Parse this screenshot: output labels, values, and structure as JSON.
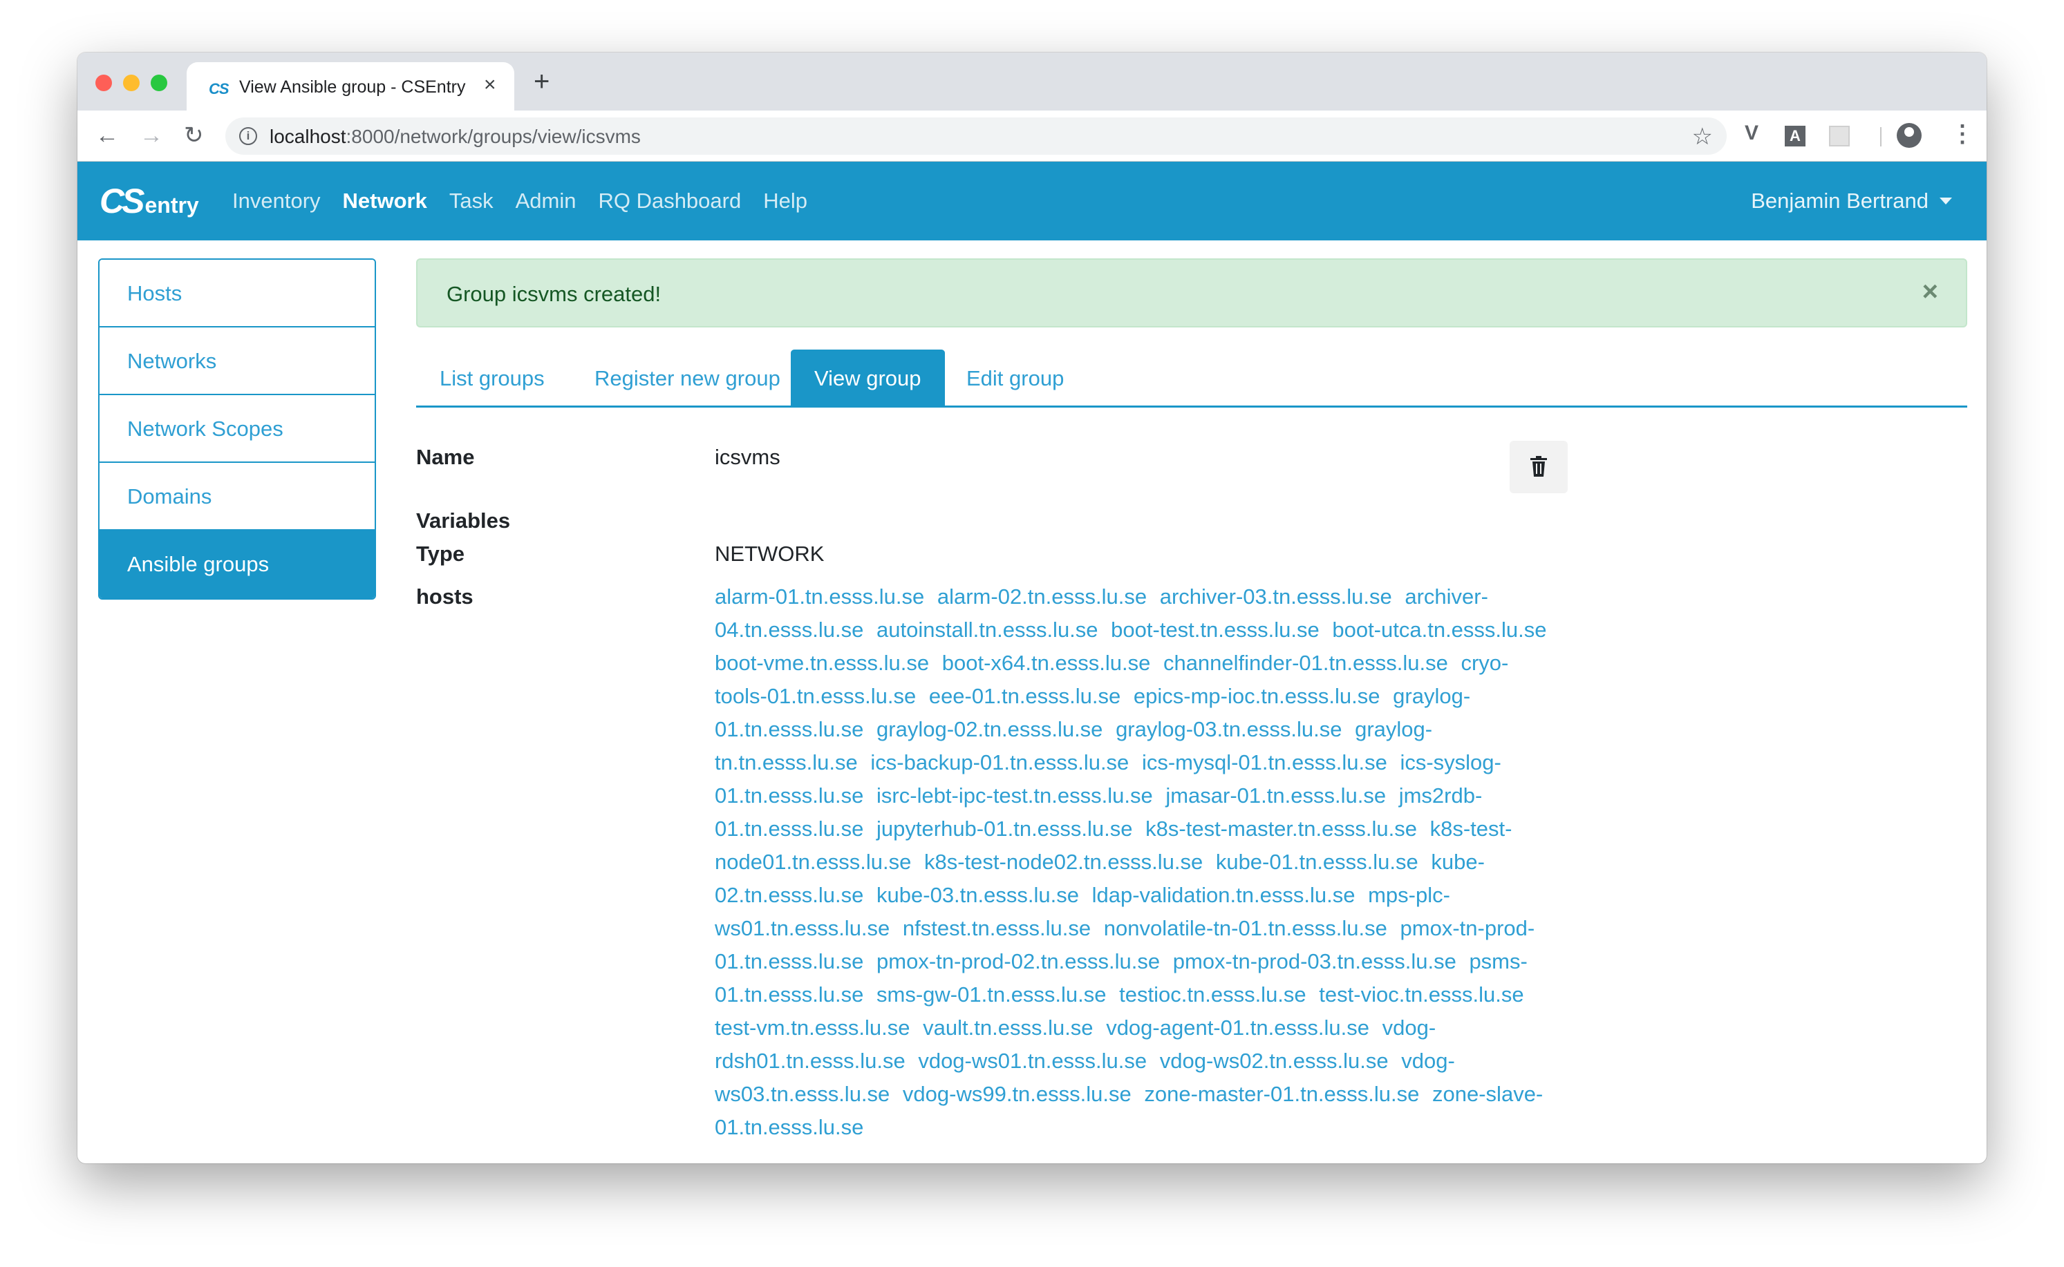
{
  "browser": {
    "tab_title": "View Ansible group - CSEntry",
    "tab_favicon": "CS",
    "tab_close": "×",
    "new_tab": "+",
    "url_host": "localhost",
    "url_path": ":8000/network/groups/view/icsvms"
  },
  "navbar": {
    "brand_cs": "CS",
    "brand_entry": "entry",
    "links": [
      "Inventory",
      "Network",
      "Task",
      "Admin",
      "RQ Dashboard",
      "Help"
    ],
    "active_link": "Network",
    "user": "Benjamin Bertrand"
  },
  "sidebar": {
    "items": [
      "Hosts",
      "Networks",
      "Network Scopes",
      "Domains",
      "Ansible groups"
    ],
    "active": "Ansible groups"
  },
  "alert": {
    "message": "Group icsvms created!",
    "close": "×"
  },
  "tabs": {
    "items": [
      "List groups",
      "Register new group",
      "View group",
      "Edit group"
    ],
    "active": "View group"
  },
  "details": {
    "name_label": "Name",
    "name_value": "icsvms",
    "variables_label": "Variables",
    "type_label": "Type",
    "type_value": "NETWORK",
    "hosts_label": "hosts",
    "hosts": [
      "alarm-01.tn.esss.lu.se",
      "alarm-02.tn.esss.lu.se",
      "archiver-03.tn.esss.lu.se",
      "archiver-04.tn.esss.lu.se",
      "autoinstall.tn.esss.lu.se",
      "boot-test.tn.esss.lu.se",
      "boot-utca.tn.esss.lu.se",
      "boot-vme.tn.esss.lu.se",
      "boot-x64.tn.esss.lu.se",
      "channelfinder-01.tn.esss.lu.se",
      "cryo-tools-01.tn.esss.lu.se",
      "eee-01.tn.esss.lu.se",
      "epics-mp-ioc.tn.esss.lu.se",
      "graylog-01.tn.esss.lu.se",
      "graylog-02.tn.esss.lu.se",
      "graylog-03.tn.esss.lu.se",
      "graylog-tn.tn.esss.lu.se",
      "ics-backup-01.tn.esss.lu.se",
      "ics-mysql-01.tn.esss.lu.se",
      "ics-syslog-01.tn.esss.lu.se",
      "isrc-lebt-ipc-test.tn.esss.lu.se",
      "jmasar-01.tn.esss.lu.se",
      "jms2rdb-01.tn.esss.lu.se",
      "jupyterhub-01.tn.esss.lu.se",
      "k8s-test-master.tn.esss.lu.se",
      "k8s-test-node01.tn.esss.lu.se",
      "k8s-test-node02.tn.esss.lu.se",
      "kube-01.tn.esss.lu.se",
      "kube-02.tn.esss.lu.se",
      "kube-03.tn.esss.lu.se",
      "ldap-validation.tn.esss.lu.se",
      "mps-plc-ws01.tn.esss.lu.se",
      "nfstest.tn.esss.lu.se",
      "nonvolatile-tn-01.tn.esss.lu.se",
      "pmox-tn-prod-01.tn.esss.lu.se",
      "pmox-tn-prod-02.tn.esss.lu.se",
      "pmox-tn-prod-03.tn.esss.lu.se",
      "psms-01.tn.esss.lu.se",
      "sms-gw-01.tn.esss.lu.se",
      "testioc.tn.esss.lu.se",
      "test-vioc.tn.esss.lu.se",
      "test-vm.tn.esss.lu.se",
      "vault.tn.esss.lu.se",
      "vdog-agent-01.tn.esss.lu.se",
      "vdog-rdsh01.tn.esss.lu.se",
      "vdog-ws01.tn.esss.lu.se",
      "vdog-ws02.tn.esss.lu.se",
      "vdog-ws03.tn.esss.lu.se",
      "vdog-ws99.tn.esss.lu.se",
      "zone-master-01.tn.esss.lu.se",
      "zone-slave-01.tn.esss.lu.se"
    ]
  },
  "colors": {
    "brand": "#1a96c8",
    "link": "#2f9fd3",
    "alert_bg": "#d4edda",
    "alert_text": "#155724"
  },
  "icons": {
    "delete": "trash-icon",
    "star": "star-icon",
    "info": "info-icon"
  }
}
